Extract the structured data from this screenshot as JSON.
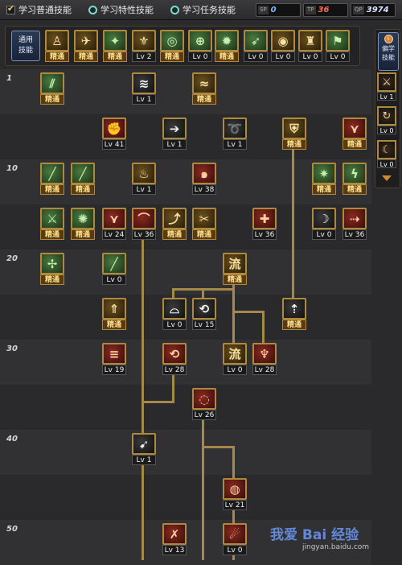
{
  "tabs": [
    {
      "label": "学习普通技能",
      "selected": true
    },
    {
      "label": "学习特性技能",
      "selected": false
    },
    {
      "label": "学习任务技能",
      "selected": false
    }
  ],
  "resources": [
    {
      "label": "SP",
      "value": "0",
      "color": "#7fb6ff"
    },
    {
      "label": "TP",
      "value": "36",
      "color": "#ff6a5a"
    },
    {
      "label": "QP",
      "value": "3974",
      "color": "#d8e6ff"
    }
  ],
  "common_skills": {
    "label": "通用技能",
    "items": [
      {
        "icon": "sit-figure-icon",
        "level": "精通",
        "style": "o"
      },
      {
        "icon": "leap-figure-icon",
        "level": "精通",
        "style": "o"
      },
      {
        "icon": "kick-figure-icon",
        "level": "精通",
        "style": "g"
      },
      {
        "icon": "wings-icon",
        "level": "Lv 2",
        "style": "o"
      },
      {
        "icon": "target-icon",
        "level": "精通",
        "style": "g"
      },
      {
        "icon": "crosshair-icon",
        "level": "Lv 0",
        "style": "g"
      },
      {
        "icon": "burst-figure-icon",
        "level": "精通",
        "style": "g"
      },
      {
        "icon": "run-figure-icon",
        "level": "Lv 0",
        "style": "g"
      },
      {
        "icon": "eye-icon",
        "level": "Lv 0",
        "style": "o"
      },
      {
        "icon": "strong-figure-icon",
        "level": "Lv 0",
        "style": "o"
      },
      {
        "icon": "flag-icon",
        "level": "Lv 0",
        "style": "g"
      }
    ]
  },
  "side_panel": {
    "label": "偏学技能",
    "items": [
      {
        "icon": "sword-slash-icon",
        "level": "Lv 1"
      },
      {
        "icon": "spiral-icon",
        "level": "Lv 0"
      },
      {
        "icon": "crescent-icon",
        "level": "Lv 0"
      }
    ]
  },
  "level_marks": [
    "1",
    "10",
    "20",
    "30",
    "40",
    "50"
  ],
  "skills": [
    {
      "icon": "slash-rain-icon",
      "level": "精通",
      "style": "g"
    },
    {
      "icon": "claw-icon",
      "level": "Lv 1",
      "style": "k"
    },
    {
      "icon": "wave-icon",
      "level": "精通",
      "style": "o"
    },
    {
      "icon": "fist-icon",
      "level": "Lv 41",
      "style": "r"
    },
    {
      "icon": "arrow-icon",
      "level": "Lv 1",
      "style": "k"
    },
    {
      "icon": "whirl-icon",
      "level": "Lv 1",
      "style": "k"
    },
    {
      "icon": "shield-sword-icon",
      "level": "精通",
      "style": "o"
    },
    {
      "icon": "fang-icon",
      "level": "精通",
      "style": "r"
    },
    {
      "icon": "blade-icon",
      "level": "精通",
      "style": "g"
    },
    {
      "icon": "blade-icon",
      "level": "精通",
      "style": "g"
    },
    {
      "icon": "flame-claw-icon",
      "level": "Lv 1",
      "style": "o"
    },
    {
      "icon": "swirl-icon",
      "level": "Lv 38",
      "style": "r"
    },
    {
      "icon": "burst-icon",
      "level": "精通",
      "style": "g"
    },
    {
      "icon": "lightning-icon",
      "level": "精通",
      "style": "g"
    },
    {
      "icon": "sword-icon",
      "level": "精通",
      "style": "g"
    },
    {
      "icon": "star-burst-icon",
      "level": "精通",
      "style": "g"
    },
    {
      "icon": "fang-icon",
      "level": "Lv 24",
      "style": "r"
    },
    {
      "icon": "arc-icon",
      "level": "Lv 36",
      "style": "r"
    },
    {
      "icon": "run-slash-icon",
      "level": "精通",
      "style": "o"
    },
    {
      "icon": "scissors-icon",
      "level": "精通",
      "style": "o"
    },
    {
      "icon": "cross-icon",
      "level": "Lv 36",
      "style": "r"
    },
    {
      "icon": "moon-icon",
      "level": "Lv 0",
      "style": "k"
    },
    {
      "icon": "dash-icon",
      "level": "Lv 36",
      "style": "r"
    },
    {
      "icon": "thorn-icon",
      "level": "精通",
      "style": "g"
    },
    {
      "icon": "blade-icon",
      "level": "Lv 0",
      "style": "g"
    },
    {
      "icon": "liu-glyph-icon",
      "level": "精通",
      "style": "o"
    },
    {
      "icon": "rise-icon",
      "level": "精通",
      "style": "o"
    },
    {
      "icon": "arc-slash-icon",
      "level": "Lv 0",
      "style": "k"
    },
    {
      "icon": "spin-icon",
      "level": "Lv 15",
      "style": "k"
    },
    {
      "icon": "sword-up-icon",
      "level": "精通",
      "style": "k"
    },
    {
      "icon": "crest-icon",
      "level": "Lv 19",
      "style": "r"
    },
    {
      "icon": "spin-icon",
      "level": "Lv 28",
      "style": "r"
    },
    {
      "icon": "liu-glyph-icon",
      "level": "Lv 0",
      "style": "o"
    },
    {
      "icon": "flame-icon",
      "level": "Lv 28",
      "style": "r"
    },
    {
      "icon": "ring-icon",
      "level": "Lv 26",
      "style": "r"
    },
    {
      "icon": "swoop-icon",
      "level": "Lv 1",
      "style": "k"
    },
    {
      "icon": "orb-icon",
      "level": "Lv 21",
      "style": "r"
    },
    {
      "icon": "strike-icon",
      "level": "Lv 13",
      "style": "r"
    },
    {
      "icon": "fire-icon",
      "level": "Lv 0",
      "style": "r"
    }
  ],
  "watermark": {
    "main": "我爱 Bai 经验",
    "sub": "jingyan.baidu.com"
  }
}
